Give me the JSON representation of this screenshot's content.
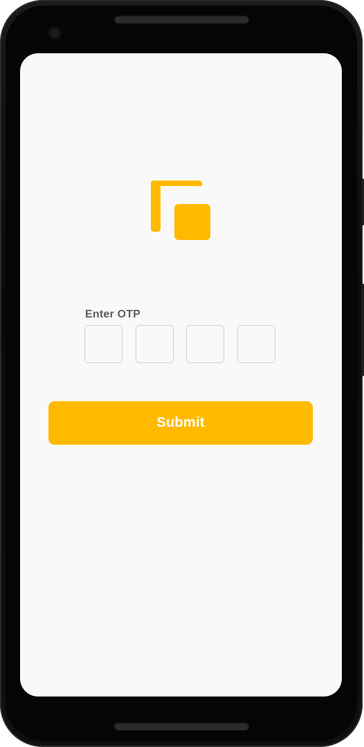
{
  "brand": {
    "logo_icon": "yellow-layered-squares-logo-icon",
    "accent_color": "#ffba00"
  },
  "otp": {
    "label": "Enter OTP",
    "digits": [
      "",
      "",
      "",
      ""
    ]
  },
  "actions": {
    "submit_label": "Submit"
  }
}
